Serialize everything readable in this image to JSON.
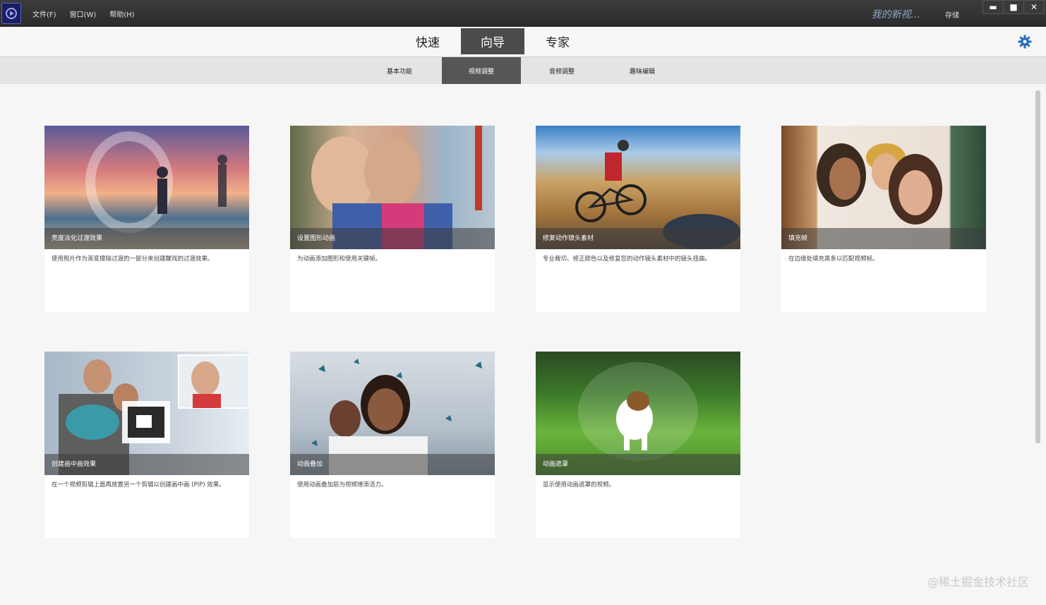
{
  "window": {
    "menu": [
      "文件(F)",
      "窗口(W)",
      "帮助(H)"
    ],
    "project_title": "我的新视...",
    "save_label": "存储",
    "controls": [
      "▬",
      "■",
      "✕"
    ]
  },
  "modes": [
    {
      "label": "快速",
      "active": false
    },
    {
      "label": "向导",
      "active": true
    },
    {
      "label": "专家",
      "active": false
    }
  ],
  "subtabs": [
    {
      "label": "基本功能",
      "active": false
    },
    {
      "label": "视频调整",
      "active": true
    },
    {
      "label": "音频调整",
      "active": false
    },
    {
      "label": "趣味编辑",
      "active": false
    }
  ],
  "cards": [
    {
      "title": "亮度淡化过渡效果",
      "desc": "使用照片作为渐变擦除过渡的一部分来创建醒戏的过渡效果。"
    },
    {
      "title": "设置图形动画",
      "desc": "为动画添加图形和使用关键帧。"
    },
    {
      "title": "修复动作镜头素材",
      "desc": "专业裁切、修正颜色以及修复您的动作镜头素材中的镜头扭曲。"
    },
    {
      "title": "填充帧",
      "desc": "在边缘处填充黑条以匹配视频帧。"
    },
    {
      "title": "创建画中画效果",
      "desc": "在一个视频剪辑上面再放置另一个剪辑以创建画中画 (PIP) 效果。"
    },
    {
      "title": "动画叠加",
      "desc": "使用动画叠加层为视频增添活力。"
    },
    {
      "title": "动画遮罩",
      "desc": "显示使用动画遮罩的视频。"
    }
  ],
  "colors": {
    "active_tab": "#4b4b4b",
    "gear": "#2a6fb8"
  },
  "watermark": "@稀土掘金技术社区"
}
